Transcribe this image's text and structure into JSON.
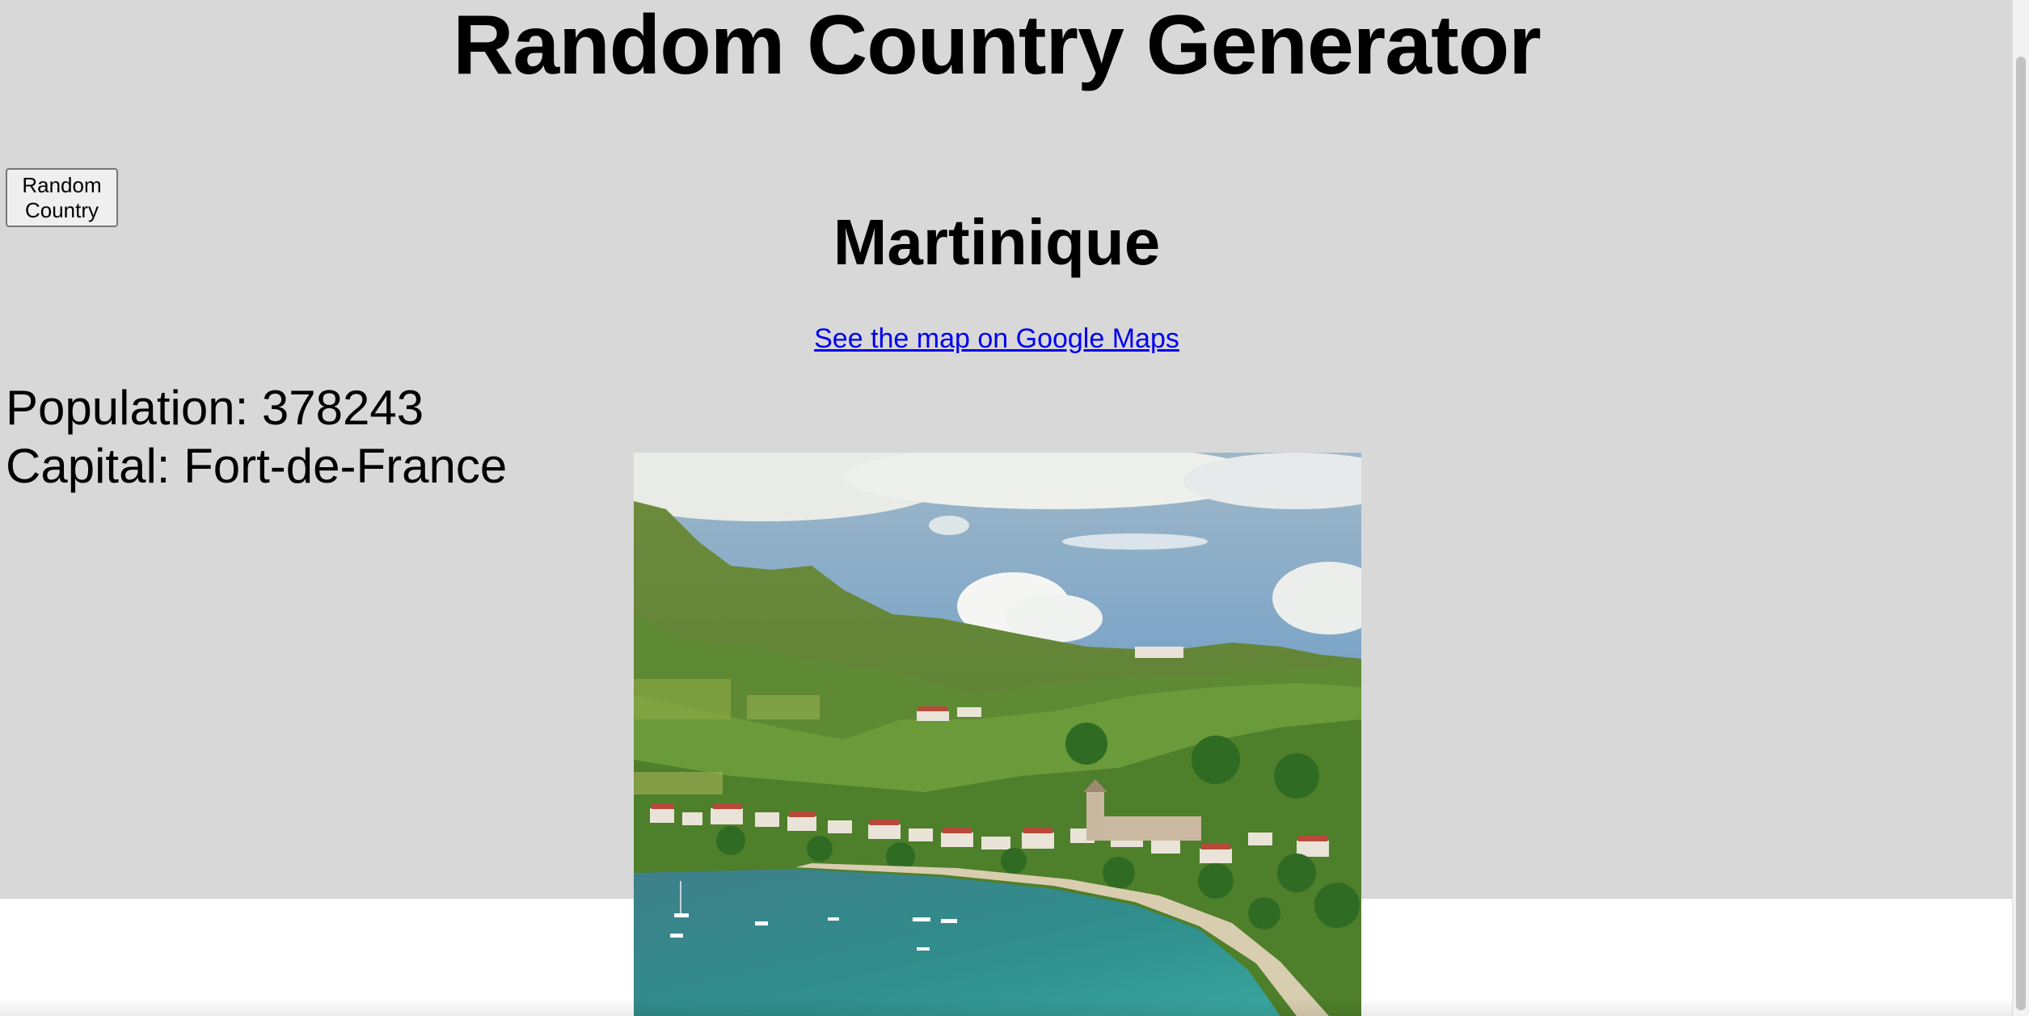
{
  "page": {
    "title": "Random Country Generator",
    "background_color": "#d8d8d8"
  },
  "controls": {
    "random_button_label": "Random Country"
  },
  "country": {
    "name": "Martinique",
    "map_link_text": "See the map on Google Maps",
    "population_label": "Population:",
    "population_value": "378243",
    "capital_label": "Capital:",
    "capital_value": "Fort-de-France",
    "image_description_icon": "country-photo"
  },
  "colors": {
    "link": "#0000ee",
    "text": "#000000"
  }
}
